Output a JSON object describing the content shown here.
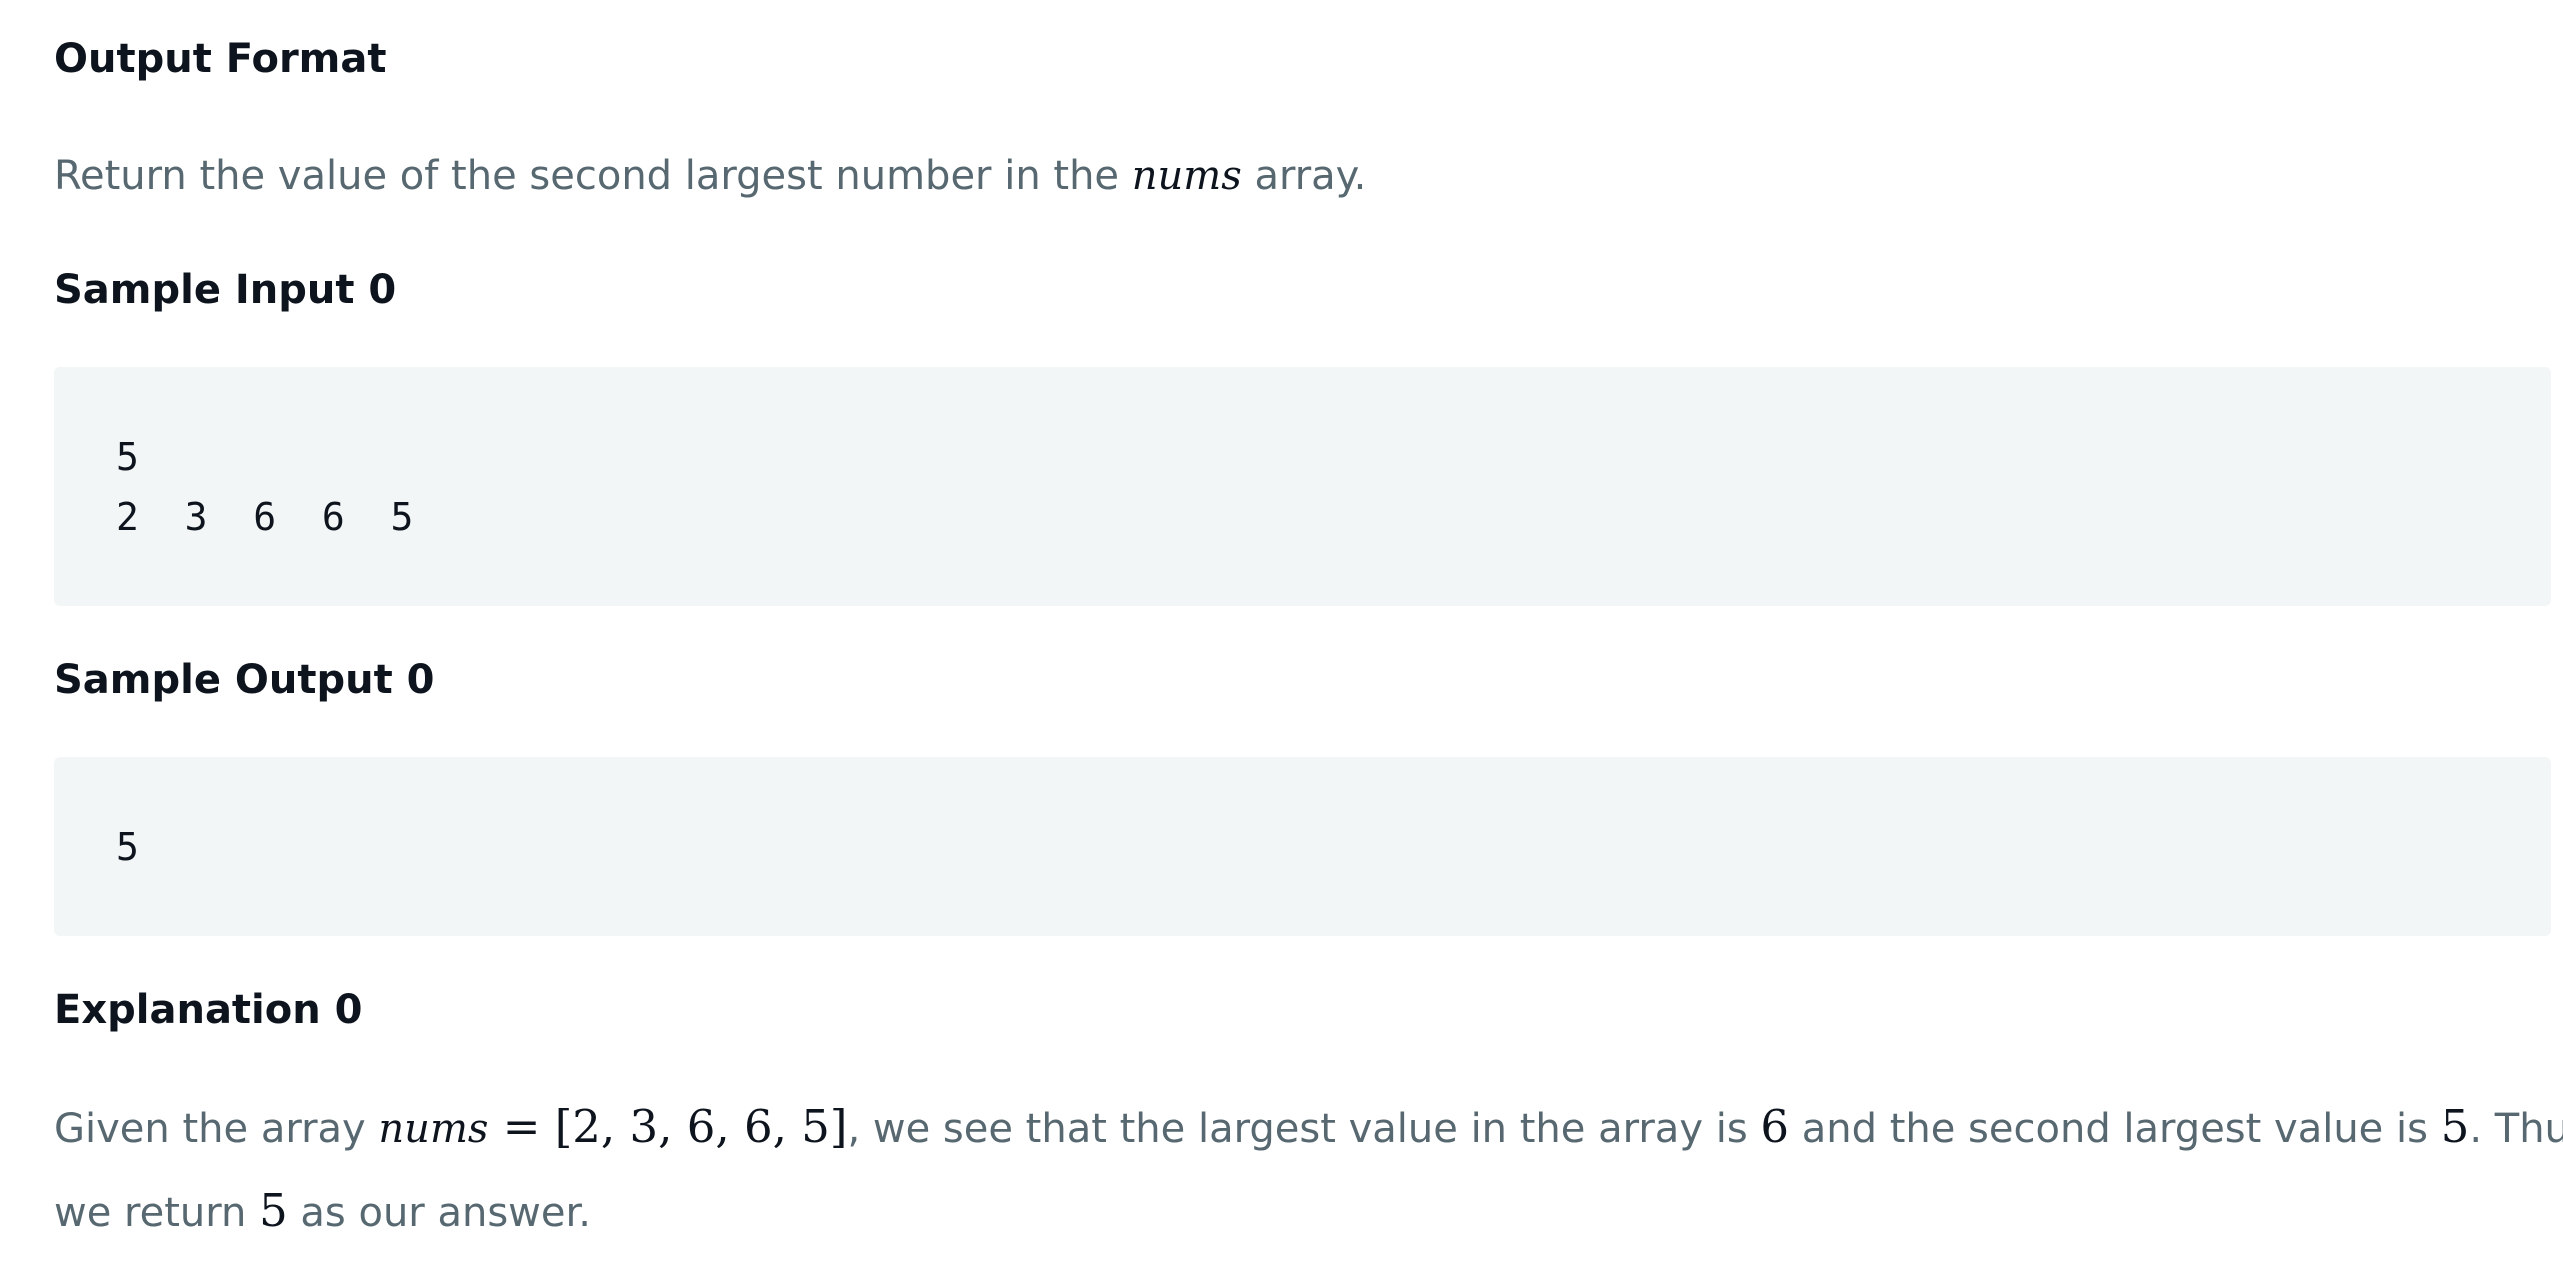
{
  "output_format": {
    "title": "Output Format",
    "text_before": "Return the value of the second largest number in the ",
    "variable": "nums",
    "text_after": " array."
  },
  "sample_input": {
    "title": "Sample Input 0",
    "lines": [
      "5",
      "2  3  6  6  5"
    ]
  },
  "sample_output": {
    "title": "Sample Output 0",
    "lines": [
      "5"
    ]
  },
  "explanation": {
    "title": "Explanation 0",
    "text_1": "Given the array ",
    "variable": "nums",
    "equals": " = ",
    "array": "[2, 3, 6, 6, 5]",
    "text_2": ", we see that the largest value in the array is ",
    "largest": "6",
    "text_3": " and the second largest value is ",
    "second": "5",
    "text_4": ". Thus,",
    "line2_text_1": "we return ",
    "answer": "5",
    "line2_text_2": " as our answer."
  }
}
